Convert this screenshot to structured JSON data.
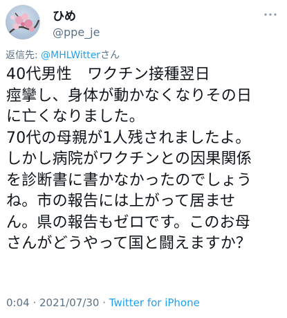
{
  "user": {
    "display_name": "ひめ",
    "handle": "@ppe_je"
  },
  "reply": {
    "prefix": "返信先: ",
    "target": "@MHLWitter",
    "suffix": "さん"
  },
  "tweet": {
    "lines": [
      "40代男性　ワクチン接種翌日",
      "痙攣し、身体が動かなくなりその日",
      "に亡くなりました。",
      "70代の母親が1人残されましたよ。",
      "しかし病院がワクチンとの因果関係",
      "を診断書に書かなかったのでしょう",
      "ね。市の報告には上がって居ませ",
      "ん。県の報告もゼロです。このお母",
      "さんがどうやって国と闘えますか？"
    ]
  },
  "meta": {
    "time": "0:04",
    "separator": " · ",
    "date": "2021/07/30",
    "source": "Twitter for iPhone"
  },
  "colors": {
    "text": "#0f1419",
    "secondary": "#5b7083",
    "link": "#1da1f2"
  },
  "icons": {
    "avatar": "avatar-image",
    "more": "more-options-icon"
  }
}
